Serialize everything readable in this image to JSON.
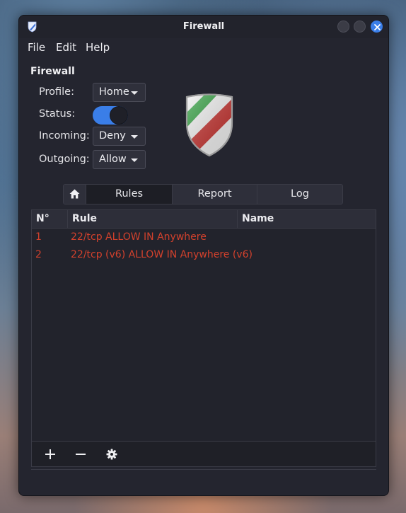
{
  "window": {
    "title": "Firewall"
  },
  "menu": {
    "items": [
      "File",
      "Edit",
      "Help"
    ]
  },
  "section_title": "Firewall",
  "fields": {
    "profile": {
      "label": "Profile:",
      "value": "Home"
    },
    "status": {
      "label": "Status:",
      "enabled": true
    },
    "incoming": {
      "label": "Incoming:",
      "value": "Deny"
    },
    "outgoing": {
      "label": "Outgoing:",
      "value": "Allow"
    }
  },
  "tabs": [
    "Rules",
    "Report",
    "Log"
  ],
  "active_tab": "Rules",
  "table": {
    "headers": [
      "N°",
      "Rule",
      "Name"
    ],
    "rows": [
      {
        "no": "1",
        "rule": "22/tcp ALLOW IN Anywhere",
        "name": ""
      },
      {
        "no": "2",
        "rule": "22/tcp (v6) ALLOW IN Anywhere (v6)",
        "name": ""
      }
    ]
  },
  "toolbar": {
    "icons": [
      "add-icon",
      "remove-icon",
      "settings-icon"
    ]
  },
  "colors": {
    "accent": "#3a7ee8",
    "rule_text": "#d2412c",
    "window_bg": "#24252f"
  }
}
